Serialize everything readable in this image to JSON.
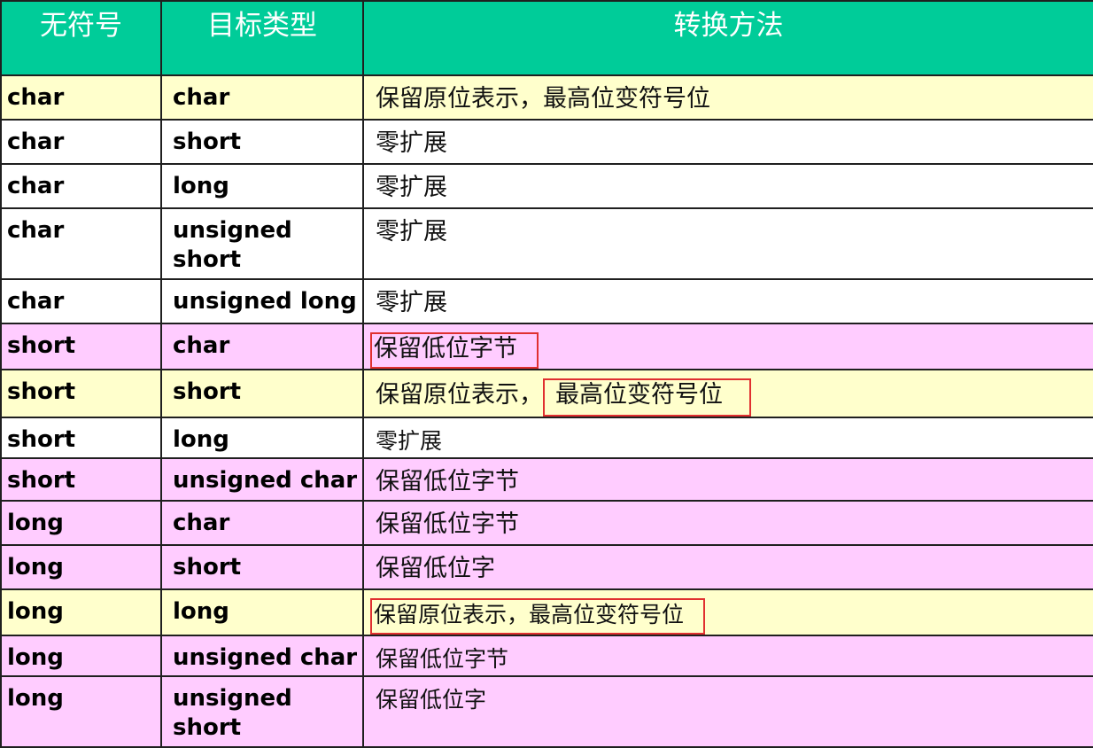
{
  "header": {
    "col_unsigned": "无符号",
    "col_target": "目标类型",
    "col_method": "转换方法"
  },
  "colors": {
    "header": "#00cc99",
    "yellow_row": "#ffffcc",
    "white_row": "#ffffff",
    "pink_row": "#ffccff",
    "highlight_box": "#e03030"
  },
  "rows": [
    {
      "src": "char",
      "tgt": "char",
      "method": "保留原位表示，最高位变符号位",
      "bg": "yellow"
    },
    {
      "src": "char",
      "tgt": "short",
      "method": "零扩展",
      "bg": "white"
    },
    {
      "src": "char",
      "tgt": "long",
      "method": "零扩展",
      "bg": "white"
    },
    {
      "src": "char",
      "tgt": "unsigned short",
      "method": "零扩展",
      "bg": "white"
    },
    {
      "src": "char",
      "tgt": "unsigned long",
      "method": "零扩展",
      "bg": "white"
    },
    {
      "src": "short",
      "tgt": "char",
      "method": "保留低位字节",
      "bg": "pink",
      "highlight": "full"
    },
    {
      "src": "short",
      "tgt": "short",
      "method_a": "保留原位表示，",
      "method_b": "最高位变符号位",
      "bg": "yellow",
      "highlight": "tail"
    },
    {
      "src": "short",
      "tgt": "long",
      "method": "零扩展",
      "bg": "white"
    },
    {
      "src": "short",
      "tgt": "unsigned char",
      "method": "保留低位字节",
      "bg": "pink"
    },
    {
      "src": "long",
      "tgt": "char",
      "method": "保留低位字节",
      "bg": "pink"
    },
    {
      "src": "long",
      "tgt": "short",
      "method": "保留低位字",
      "bg": "pink"
    },
    {
      "src": "long",
      "tgt": "long",
      "method": "保留原位表示，最高位变符号位",
      "bg": "yellow",
      "highlight": "full"
    },
    {
      "src": "long",
      "tgt": "unsigned char",
      "method": "保留低位字节",
      "bg": "pink"
    },
    {
      "src": "long",
      "tgt": "unsigned short",
      "method": "保留低位字",
      "bg": "pink"
    }
  ]
}
